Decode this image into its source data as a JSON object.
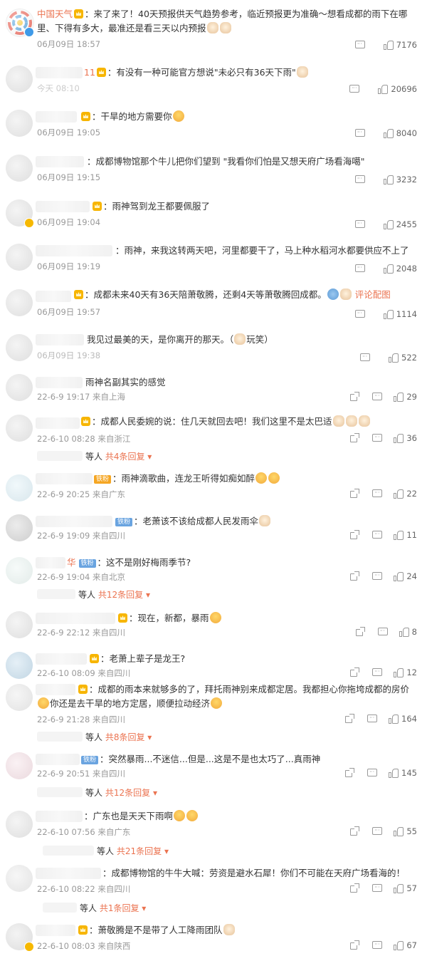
{
  "comments": [
    {
      "name": "中国天气",
      "text": "：来了来了！40天预报供天气趋势参考，临近预报更为准确～想看成都的雨下在哪里、下得有多大，最准还是看三天以内预报",
      "time": "06月09日 18:57",
      "likes": "7176"
    },
    {
      "name_tail": "11",
      "text": "：有没有一种可能官方想说\"未必只有36天下雨\"",
      "time": "今天 08:10",
      "likes": "20696"
    },
    {
      "text": "：干旱的地方需要你",
      "time": "06月09日 19:05",
      "likes": "8040"
    },
    {
      "text": "：成都博物馆那个牛儿把你们望到 \"我看你们怕是又想天府广场看海噶\"",
      "time": "06月09日 19:15",
      "likes": "3232"
    },
    {
      "text": "：雨神驾到龙王都要佩服了",
      "time": "06月09日 19:04",
      "likes": "2455"
    },
    {
      "text": "：雨神，来我这转两天吧，河里都要干了，马上种水稻河水都要供应不上了",
      "time": "06月09日 19:19",
      "likes": "2048"
    },
    {
      "text": "：成都未来40天有36天陪萧敬腾，还剩4天等萧敬腾回成都。",
      "link": "评论配图",
      "time": "06月09日 19:57",
      "likes": "1114"
    },
    {
      "text": "我见过最美的天，是你离开的那天。（",
      "text_end": "玩笑）",
      "time": "06月09日 19:38",
      "likes": "522"
    },
    {
      "text": "雨神名副其实的感觉",
      "time": "22-6-9 19:17 来自上海",
      "likes": "29"
    },
    {
      "text": "：成都人民委婉的说：住几天就回去吧！我们这里不是太巴适",
      "time": "22-6-10 08:28 来自浙江",
      "likes": "36",
      "replies_suffix": "等人",
      "replies": "共4条回复"
    },
    {
      "tag": "铁粉",
      "text": "：雨神滴歌曲，连龙王听得如痴如醉",
      "time": "22-6-9 20:25 来自广东",
      "likes": "22"
    },
    {
      "tag": "铁粉",
      "text": "：老萧该不该给成都人民发雨伞",
      "time": "22-6-9 19:09 来自四川",
      "likes": "11"
    },
    {
      "name_tail": "华",
      "tag": "铁粉",
      "text": "：这不是刚好梅雨季节?",
      "time": "22-6-9 19:04 来自北京",
      "likes": "24",
      "replies_suffix": "等人",
      "replies": "共12条回复"
    },
    {
      "text": "：现在，新都，暴雨",
      "time": "22-6-9 22:12 来自四川",
      "likes": "8"
    },
    {
      "text": "：老萧上辈子是龙王?",
      "time": "22-6-10 08:09 来自四川",
      "likes": "12"
    },
    {
      "text": "：成都的雨本来就够多的了，拜托雨神别来成都定居。我都担心你拖垮成都的房价",
      "text2": "你还是去干旱的地方定居，顺便拉动经济",
      "time": "22-6-9 21:28 来自四川",
      "likes": "164",
      "replies_suffix": "等人",
      "replies": "共8条回复"
    },
    {
      "tag": "铁粉",
      "text": "：突然暴雨...不迷信...但是...这是不是也太巧了...真雨神",
      "time": "22-6-9 20:51 来自四川",
      "likes": "145",
      "replies_suffix": "等人",
      "replies": "共12条回复"
    },
    {
      "text": "：广东也是天天下雨啊",
      "time": "22-6-10 07:56 来自广东",
      "likes": "55",
      "replies_suffix": "等人",
      "replies": "共21条回复"
    },
    {
      "text": "：成都博物馆的牛牛大喊：劳资是避水石犀！你们不可能在天府广场看海的！",
      "time": "22-6-10 08:22 来自四川",
      "likes": "57",
      "replies_suffix": "等人",
      "replies": "共1条回复"
    },
    {
      "text": "：萧敬腾是不是带了人工降雨团队",
      "time": "22-6-10 08:03 来自陕西",
      "likes": "67"
    }
  ]
}
